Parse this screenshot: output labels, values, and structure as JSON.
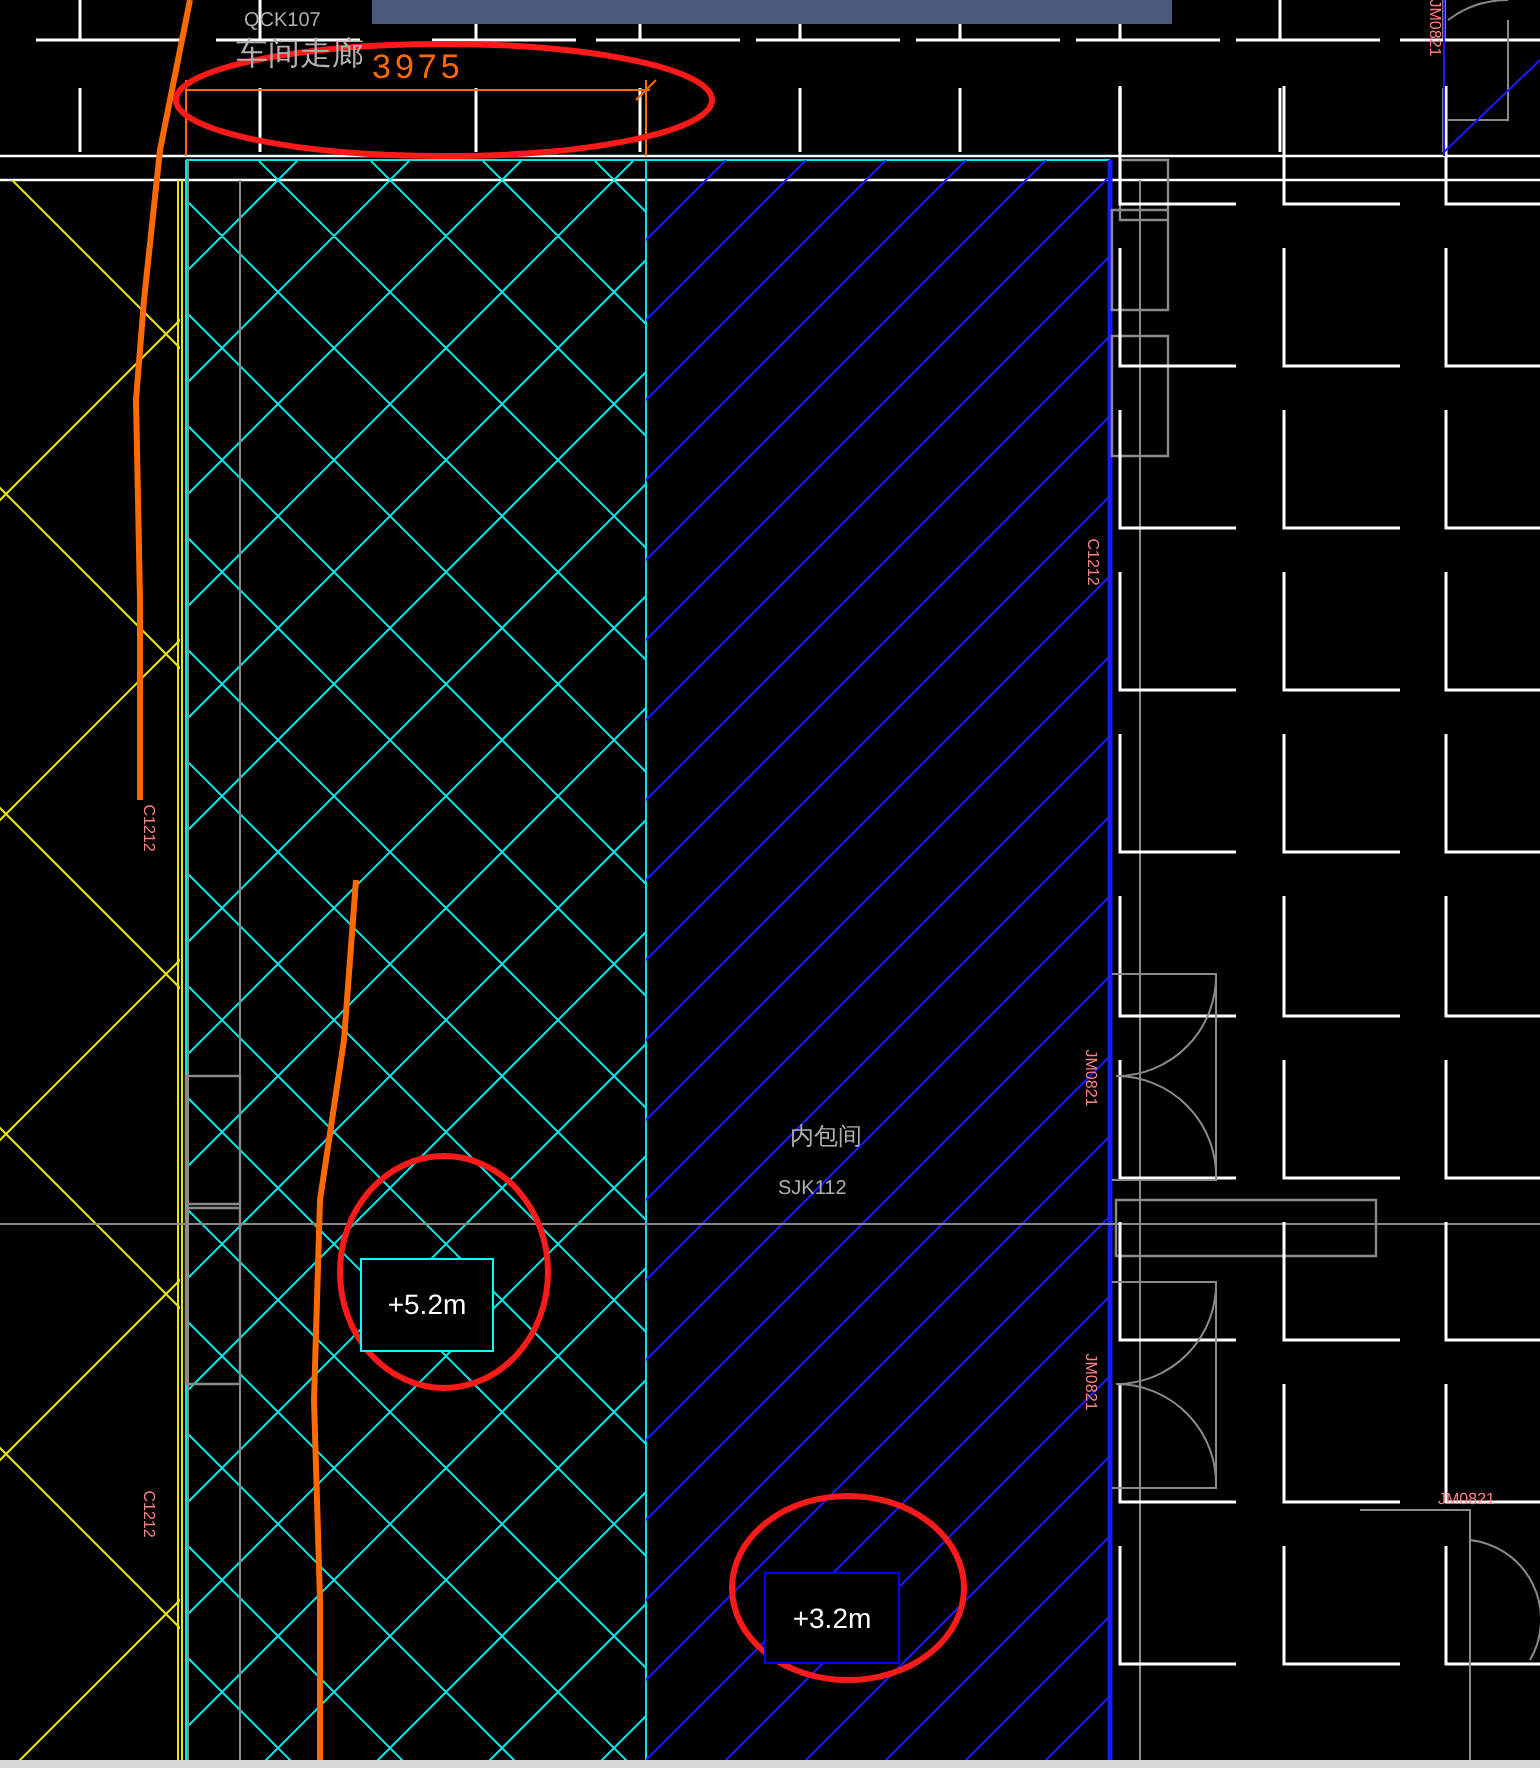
{
  "room_labels": [
    {
      "code": "QCK107",
      "name": "车间走廊"
    },
    {
      "code": "SJK112",
      "name": "内包间"
    }
  ],
  "dimension": {
    "value": "3975"
  },
  "elevation_tags": [
    {
      "text": "+5.2m",
      "color": "#00ffff"
    },
    {
      "text": "+3.2m",
      "color": "#0000ff"
    }
  ],
  "opening_tags": [
    "C1212",
    "C1212",
    "C1212",
    "JM0821",
    "JM0821",
    "JM0821",
    "JM0821"
  ]
}
